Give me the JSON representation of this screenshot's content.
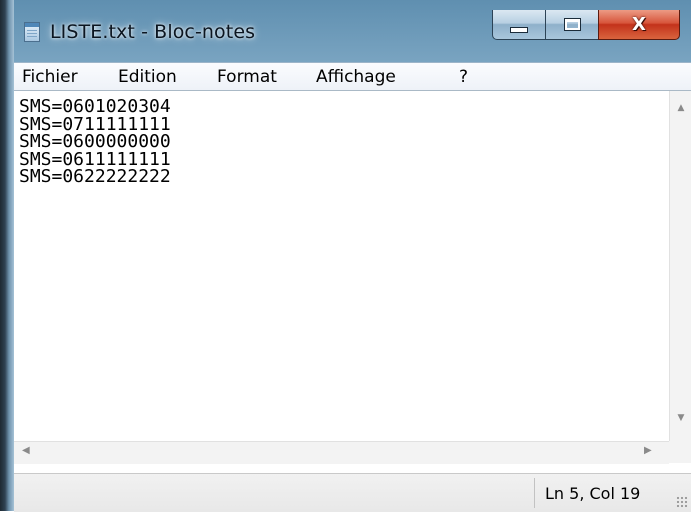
{
  "window": {
    "title": "LISTE.txt - Bloc-notes",
    "close_glyph": "X",
    "icon": "notepad-icon"
  },
  "menu": {
    "items": [
      "Fichier",
      "Edition",
      "Format",
      "Affichage",
      "?"
    ]
  },
  "editor": {
    "lines": [
      "SMS=0601020304",
      "SMS=0711111111",
      "SMS=0600000000",
      "SMS=0611111111",
      "SMS=0622222222"
    ]
  },
  "status": {
    "position": "Ln 5, Col 19"
  },
  "colors": {
    "close_button": "#c3321b",
    "frame": "#a9c6da"
  }
}
